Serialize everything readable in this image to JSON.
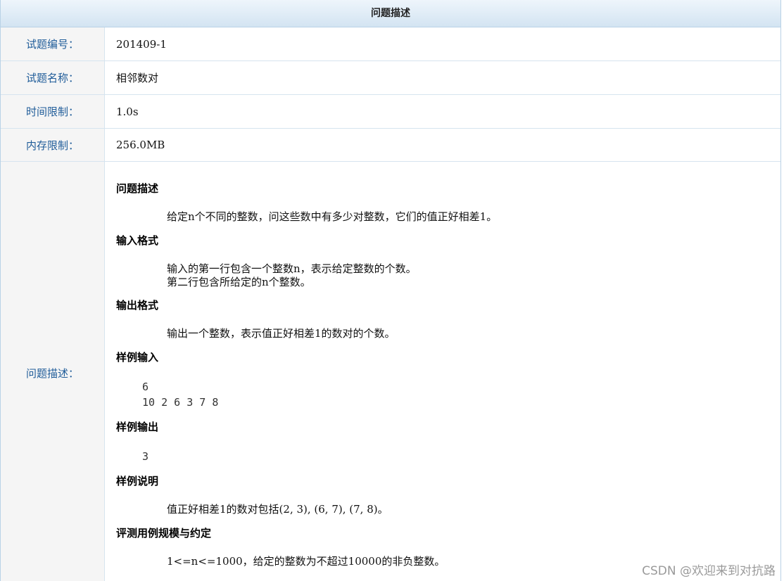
{
  "header": {
    "title": "问题描述"
  },
  "rows": [
    {
      "label": "试题编号：",
      "value": "201409-1"
    },
    {
      "label": "试题名称：",
      "value": "相邻数对"
    },
    {
      "label": "时间限制：",
      "value": "1.0s"
    },
    {
      "label": "内存限制：",
      "value": "256.0MB"
    }
  ],
  "description": {
    "label": "问题描述：",
    "sections": {
      "problem": {
        "title": "问题描述",
        "text": "给定n个不同的整数，问这些数中有多少对整数，它们的值正好相差1。"
      },
      "input_format": {
        "title": "输入格式",
        "line1": "输入的第一行包含一个整数n，表示给定整数的个数。",
        "line2": "第二行包含所给定的n个整数。"
      },
      "output_format": {
        "title": "输出格式",
        "text": "输出一个整数，表示值正好相差1的数对的个数。"
      },
      "sample_input": {
        "title": "样例输入",
        "line1": "6",
        "line2": "10 2 6 3 7 8"
      },
      "sample_output": {
        "title": "样例输出",
        "line1": "3"
      },
      "sample_explanation": {
        "title": "样例说明",
        "text": "值正好相差1的数对包括(2, 3), (6, 7), (7, 8)。"
      },
      "constraints": {
        "title": "评测用例规模与约定",
        "text": "1<=n<=1000，给定的整数为不超过10000的非负整数。"
      }
    }
  },
  "watermark": "CSDN @欢迎来到对抗路"
}
